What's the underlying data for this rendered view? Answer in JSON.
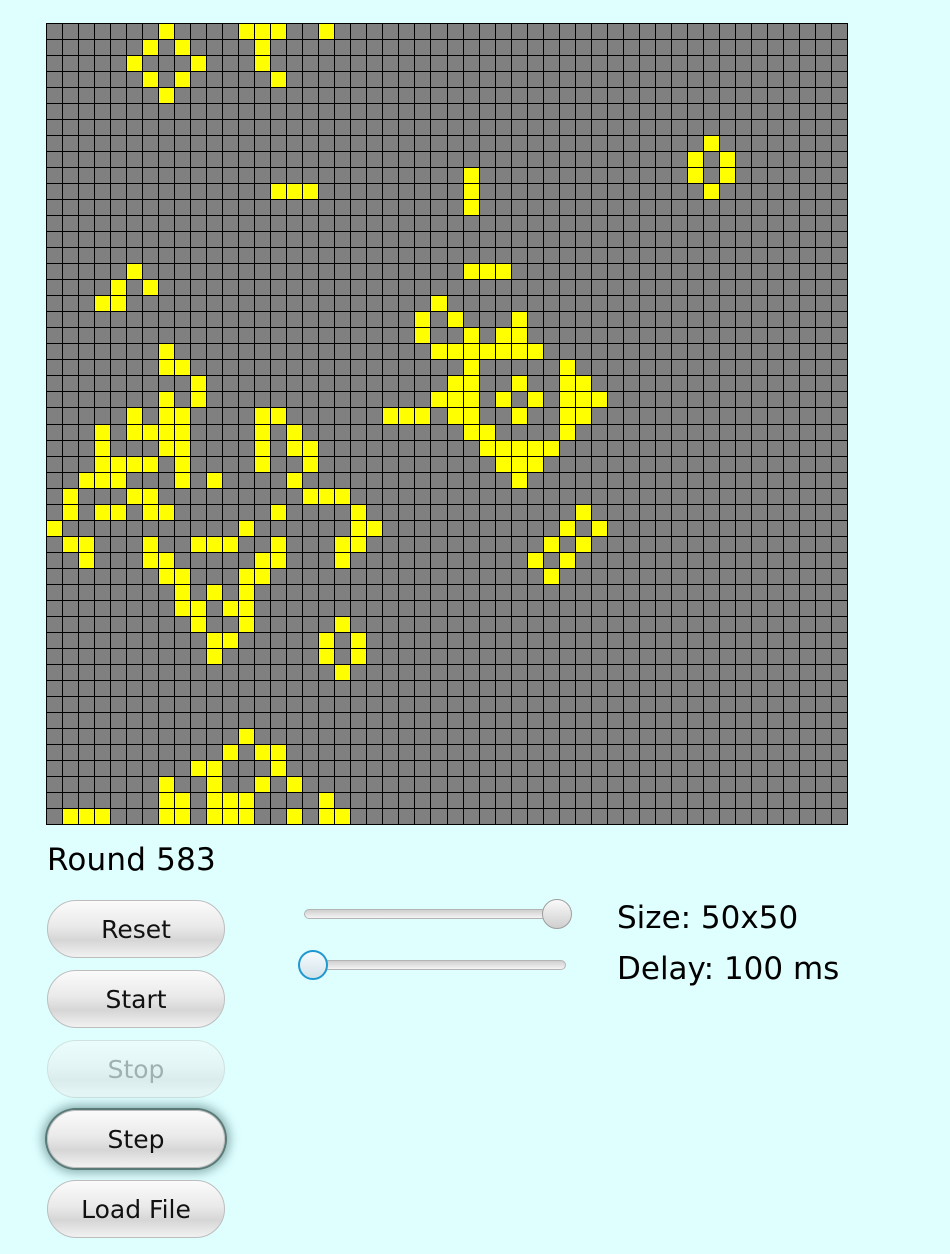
{
  "round": {
    "label": "Round 583"
  },
  "buttons": {
    "reset": "Reset",
    "start": "Start",
    "stop": "Stop",
    "step": "Step",
    "load_file": "Load File"
  },
  "sliders": {
    "size": {
      "value_fraction": 1.0
    },
    "delay": {
      "value_fraction": 0.0
    }
  },
  "info": {
    "size": "Size: 50x50",
    "delay": "Delay: 100 ms"
  },
  "colors": {
    "background": "#dfffff",
    "dead_cell": "#808080",
    "alive_cell": "#ffff00",
    "grid_line": "#000000"
  },
  "board": {
    "rows": 50,
    "cols": 50,
    "alive_cells": [
      [
        0,
        7
      ],
      [
        0,
        12
      ],
      [
        0,
        13
      ],
      [
        0,
        14
      ],
      [
        0,
        17
      ],
      [
        1,
        6
      ],
      [
        1,
        8
      ],
      [
        1,
        13
      ],
      [
        2,
        5
      ],
      [
        2,
        9
      ],
      [
        2,
        13
      ],
      [
        3,
        6
      ],
      [
        3,
        8
      ],
      [
        3,
        14
      ],
      [
        4,
        7
      ],
      [
        7,
        41
      ],
      [
        8,
        40
      ],
      [
        8,
        42
      ],
      [
        9,
        40
      ],
      [
        9,
        42
      ],
      [
        10,
        41
      ],
      [
        9,
        26
      ],
      [
        10,
        26
      ],
      [
        11,
        26
      ],
      [
        10,
        14
      ],
      [
        10,
        15
      ],
      [
        10,
        16
      ],
      [
        15,
        5
      ],
      [
        16,
        4
      ],
      [
        16,
        6
      ],
      [
        17,
        3
      ],
      [
        17,
        4
      ],
      [
        15,
        26
      ],
      [
        15,
        27
      ],
      [
        15,
        28
      ],
      [
        17,
        24
      ],
      [
        18,
        23
      ],
      [
        18,
        25
      ],
      [
        18,
        29
      ],
      [
        19,
        23
      ],
      [
        19,
        26
      ],
      [
        19,
        28
      ],
      [
        19,
        29
      ],
      [
        20,
        24
      ],
      [
        20,
        25
      ],
      [
        20,
        26
      ],
      [
        20,
        27
      ],
      [
        20,
        28
      ],
      [
        20,
        29
      ],
      [
        20,
        30
      ],
      [
        21,
        26
      ],
      [
        21,
        32
      ],
      [
        22,
        25
      ],
      [
        22,
        26
      ],
      [
        22,
        29
      ],
      [
        22,
        32
      ],
      [
        22,
        33
      ],
      [
        23,
        24
      ],
      [
        23,
        25
      ],
      [
        23,
        26
      ],
      [
        23,
        28
      ],
      [
        23,
        30
      ],
      [
        23,
        32
      ],
      [
        23,
        33
      ],
      [
        23,
        34
      ],
      [
        24,
        21
      ],
      [
        24,
        22
      ],
      [
        24,
        23
      ],
      [
        24,
        25
      ],
      [
        24,
        26
      ],
      [
        24,
        29
      ],
      [
        24,
        32
      ],
      [
        24,
        33
      ],
      [
        25,
        26
      ],
      [
        25,
        27
      ],
      [
        25,
        32
      ],
      [
        26,
        27
      ],
      [
        26,
        28
      ],
      [
        26,
        29
      ],
      [
        26,
        30
      ],
      [
        26,
        31
      ],
      [
        27,
        28
      ],
      [
        27,
        29
      ],
      [
        27,
        30
      ],
      [
        28,
        29
      ],
      [
        20,
        7
      ],
      [
        21,
        7
      ],
      [
        21,
        8
      ],
      [
        22,
        9
      ],
      [
        23,
        7
      ],
      [
        23,
        9
      ],
      [
        24,
        5
      ],
      [
        24,
        7
      ],
      [
        24,
        8
      ],
      [
        24,
        13
      ],
      [
        24,
        14
      ],
      [
        25,
        3
      ],
      [
        25,
        5
      ],
      [
        25,
        6
      ],
      [
        25,
        7
      ],
      [
        25,
        8
      ],
      [
        25,
        13
      ],
      [
        25,
        15
      ],
      [
        26,
        3
      ],
      [
        26,
        7
      ],
      [
        26,
        8
      ],
      [
        26,
        13
      ],
      [
        26,
        15
      ],
      [
        26,
        16
      ],
      [
        27,
        3
      ],
      [
        27,
        4
      ],
      [
        27,
        5
      ],
      [
        27,
        6
      ],
      [
        27,
        8
      ],
      [
        27,
        13
      ],
      [
        27,
        16
      ],
      [
        28,
        2
      ],
      [
        28,
        3
      ],
      [
        28,
        4
      ],
      [
        28,
        8
      ],
      [
        28,
        10
      ],
      [
        28,
        15
      ],
      [
        29,
        1
      ],
      [
        29,
        5
      ],
      [
        29,
        6
      ],
      [
        29,
        16
      ],
      [
        29,
        17
      ],
      [
        29,
        18
      ],
      [
        30,
        1
      ],
      [
        30,
        3
      ],
      [
        30,
        4
      ],
      [
        30,
        6
      ],
      [
        30,
        7
      ],
      [
        30,
        14
      ],
      [
        30,
        19
      ],
      [
        31,
        0
      ],
      [
        31,
        12
      ],
      [
        31,
        19
      ],
      [
        31,
        20
      ],
      [
        32,
        1
      ],
      [
        32,
        2
      ],
      [
        32,
        6
      ],
      [
        32,
        9
      ],
      [
        32,
        10
      ],
      [
        32,
        11
      ],
      [
        32,
        14
      ],
      [
        32,
        18
      ],
      [
        32,
        19
      ],
      [
        33,
        2
      ],
      [
        33,
        6
      ],
      [
        33,
        7
      ],
      [
        33,
        13
      ],
      [
        33,
        14
      ],
      [
        33,
        18
      ],
      [
        34,
        7
      ],
      [
        34,
        8
      ],
      [
        34,
        12
      ],
      [
        34,
        13
      ],
      [
        35,
        8
      ],
      [
        35,
        10
      ],
      [
        35,
        12
      ],
      [
        36,
        8
      ],
      [
        36,
        9
      ],
      [
        36,
        11
      ],
      [
        36,
        12
      ],
      [
        37,
        9
      ],
      [
        37,
        12
      ],
      [
        38,
        10
      ],
      [
        38,
        11
      ],
      [
        39,
        10
      ],
      [
        30,
        33
      ],
      [
        31,
        32
      ],
      [
        31,
        34
      ],
      [
        32,
        31
      ],
      [
        32,
        33
      ],
      [
        33,
        30
      ],
      [
        33,
        32
      ],
      [
        34,
        31
      ],
      [
        37,
        18
      ],
      [
        38,
        17
      ],
      [
        38,
        19
      ],
      [
        39,
        17
      ],
      [
        39,
        19
      ],
      [
        40,
        18
      ],
      [
        44,
        12
      ],
      [
        45,
        11
      ],
      [
        45,
        13
      ],
      [
        45,
        14
      ],
      [
        46,
        9
      ],
      [
        46,
        10
      ],
      [
        46,
        14
      ],
      [
        47,
        7
      ],
      [
        47,
        10
      ],
      [
        47,
        13
      ],
      [
        47,
        15
      ],
      [
        48,
        7
      ],
      [
        48,
        8
      ],
      [
        48,
        10
      ],
      [
        48,
        11
      ],
      [
        48,
        12
      ],
      [
        48,
        17
      ],
      [
        49,
        1
      ],
      [
        49,
        2
      ],
      [
        49,
        3
      ],
      [
        49,
        7
      ],
      [
        49,
        8
      ],
      [
        49,
        10
      ],
      [
        49,
        11
      ],
      [
        49,
        12
      ],
      [
        49,
        15
      ],
      [
        49,
        17
      ],
      [
        49,
        18
      ]
    ]
  }
}
